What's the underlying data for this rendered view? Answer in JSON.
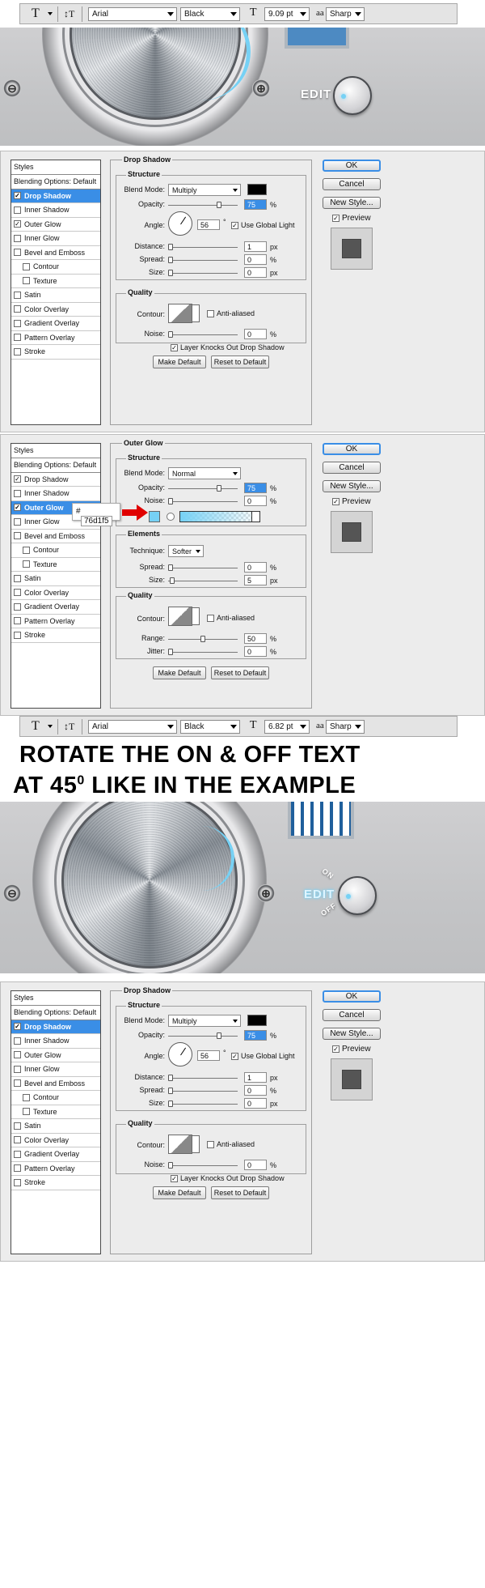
{
  "toolbar1": {
    "text_tool": "T",
    "orient_tool": "↕T",
    "font": "Arial",
    "style": "Black",
    "size_icon": "T",
    "size": "9.09 pt",
    "aa_icon": "aa",
    "antialias": "Sharp"
  },
  "scene1": {
    "edit_label": "EDIT",
    "screw": "⊖",
    "screw2": "⊕"
  },
  "styles_list": {
    "title": "Styles",
    "blending": "Blending Options: Default",
    "items": [
      "Drop Shadow",
      "Inner Shadow",
      "Outer Glow",
      "Inner Glow",
      "Bevel and Emboss",
      "Contour",
      "Texture",
      "Satin",
      "Color Overlay",
      "Gradient Overlay",
      "Pattern Overlay",
      "Stroke"
    ]
  },
  "drop_shadow": {
    "title": "Drop Shadow",
    "structure": "Structure",
    "blend_mode_label": "Blend Mode:",
    "blend_mode": "Multiply",
    "opacity_label": "Opacity:",
    "opacity": "75",
    "angle_label": "Angle:",
    "angle": "56",
    "deg": "°",
    "global_light": "Use Global Light",
    "distance_label": "Distance:",
    "distance": "1",
    "spread_label": "Spread:",
    "spread": "0",
    "size_label": "Size:",
    "size": "0",
    "quality": "Quality",
    "contour_label": "Contour:",
    "anti_aliased": "Anti-aliased",
    "noise_label": "Noise:",
    "noise": "0",
    "knockout": "Layer Knocks Out Drop Shadow",
    "make_default": "Make Default",
    "reset_default": "Reset to Default",
    "px": "px",
    "pct": "%"
  },
  "outer_glow": {
    "title": "Outer Glow",
    "structure": "Structure",
    "blend_mode_label": "Blend Mode:",
    "blend_mode": "Normal",
    "opacity_label": "Opacity:",
    "opacity": "75",
    "noise_label": "Noise:",
    "noise": "0",
    "hash": "#",
    "color_hex": "76d1f5",
    "elements": "Elements",
    "technique_label": "Technique:",
    "technique": "Softer",
    "spread_label": "Spread:",
    "spread": "0",
    "size_label": "Size:",
    "size": "5",
    "quality": "Quality",
    "contour_label": "Contour:",
    "anti_aliased": "Anti-aliased",
    "range_label": "Range:",
    "range": "50",
    "jitter_label": "Jitter:",
    "jitter": "0",
    "make_default": "Make Default",
    "reset_default": "Reset to Default",
    "px": "px",
    "pct": "%"
  },
  "buttons": {
    "ok": "OK",
    "cancel": "Cancel",
    "new_style": "New Style...",
    "preview": "Preview"
  },
  "toolbar2": {
    "text_tool": "T",
    "orient_tool": "↕T",
    "font": "Arial",
    "style": "Black",
    "size_icon": "T",
    "size": "6.82 pt",
    "aa_icon": "aa",
    "antialias": "Sharp"
  },
  "headline": {
    "line1": "ROTATE THE ON & OFF TEXT",
    "line2_prefix": "AT 45",
    "line2_sup": "0",
    "line2_suffix": " LIKE IN THE EXAMPLE"
  },
  "scene2": {
    "edit_label": "EDIT",
    "on": "ON",
    "off": "OFF"
  },
  "colors": {
    "glow": "#76d1f5",
    "highlight": "#3a8ee6",
    "red_arrow": "#e00000"
  }
}
